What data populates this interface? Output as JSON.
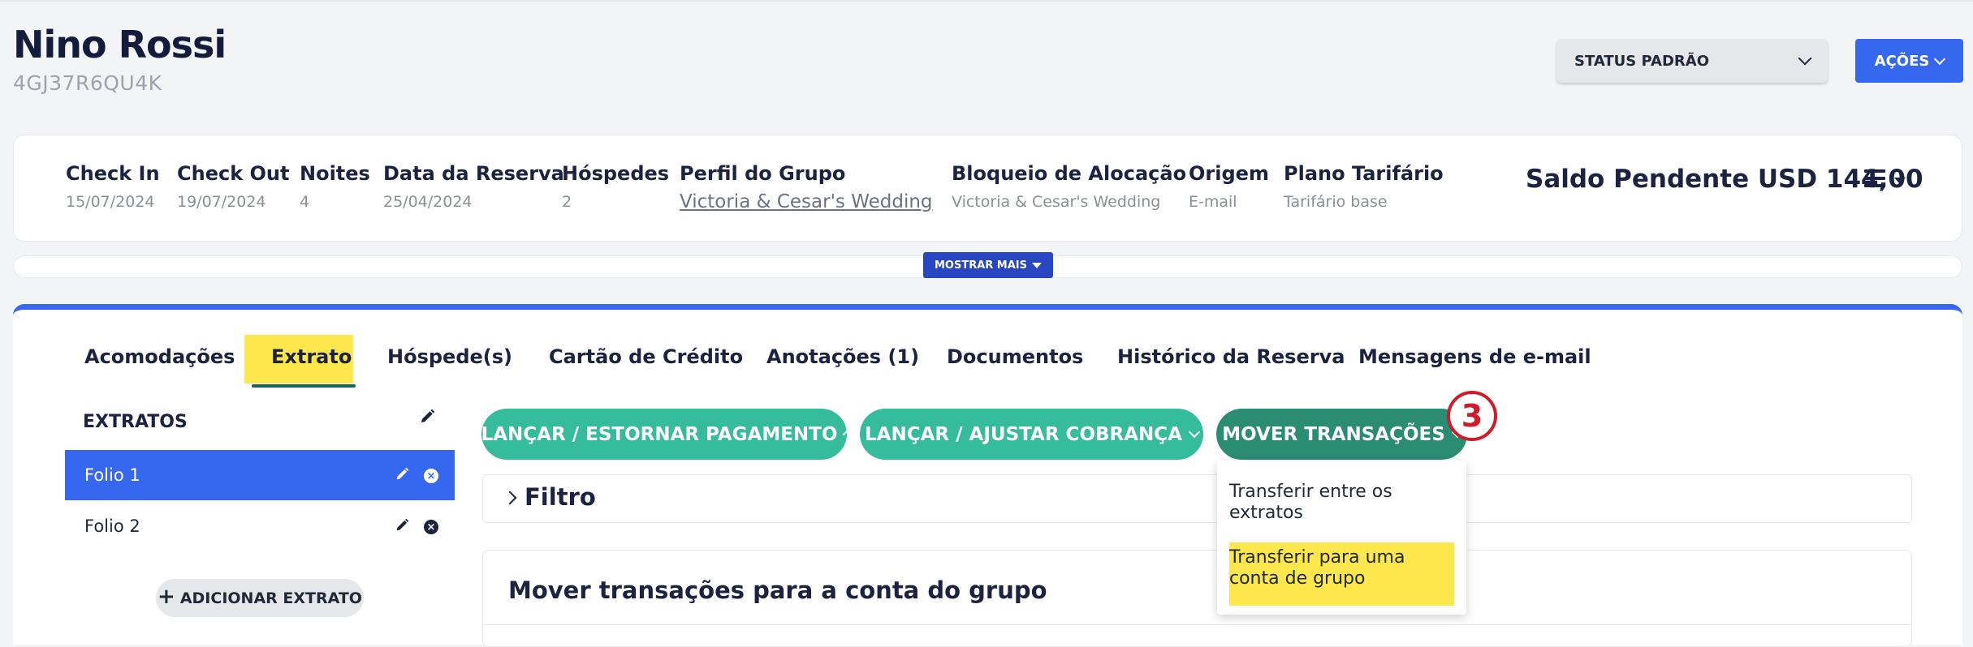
{
  "guest": {
    "name": "Nino Rossi",
    "code": "4GJ37R6QU4K"
  },
  "header": {
    "status_label": "STATUS PADRÃO",
    "actions_label": "AÇÕES"
  },
  "summary": {
    "fields": [
      {
        "label": "Check In",
        "value": "15/07/2024"
      },
      {
        "label": "Check Out",
        "value": "19/07/2024"
      },
      {
        "label": "Noites",
        "value": "4"
      },
      {
        "label": "Data da Reserva",
        "value": "25/04/2024"
      },
      {
        "label": "Hóspedes",
        "value": "2"
      },
      {
        "label": "Perfil do Grupo",
        "value": "Victoria & Cesar's Wedding"
      },
      {
        "label": "Bloqueio de Alocação",
        "value": "Victoria & Cesar's Wedding"
      },
      {
        "label": "Origem",
        "value": "E-mail"
      },
      {
        "label": "Plano Tarifário",
        "value": "Tarifário base"
      }
    ],
    "balance": "Saldo Pendente USD 144,00",
    "show_more": "MOSTRAR MAIS"
  },
  "tabs": [
    {
      "label": "Acomodações"
    },
    {
      "label": "Extrato",
      "active": true
    },
    {
      "label": "Hóspede(s)"
    },
    {
      "label": "Cartão de Crédito"
    },
    {
      "label": "Anotações (1)"
    },
    {
      "label": "Documentos"
    },
    {
      "label": "Histórico da Reserva"
    },
    {
      "label": "Mensagens de e-mail"
    }
  ],
  "folios": {
    "title": "EXTRATOS",
    "items": [
      {
        "label": "Folio 1",
        "selected": true
      },
      {
        "label": "Folio 2",
        "selected": false
      }
    ],
    "add_label": "ADICIONAR EXTRATO"
  },
  "actions": {
    "payment": "LANÇAR / ESTORNAR PAGAMENTO",
    "charge": "LANÇAR / AJUSTAR COBRANÇA",
    "move": "MOVER TRANSAÇÕES",
    "step_badge": "3",
    "move_menu": [
      "Transferir entre os extratos",
      "Transferir para uma conta de grupo"
    ]
  },
  "filter": {
    "title": "Filtro"
  },
  "move_section": {
    "title": "Mover transações para a conta do grupo"
  },
  "colors": {
    "primary_blue": "#3667f0",
    "green": "#34bc9c",
    "dark_green": "#2a8c73",
    "highlight_yellow": "#fde74c",
    "badge_red": "#d11a2a"
  }
}
